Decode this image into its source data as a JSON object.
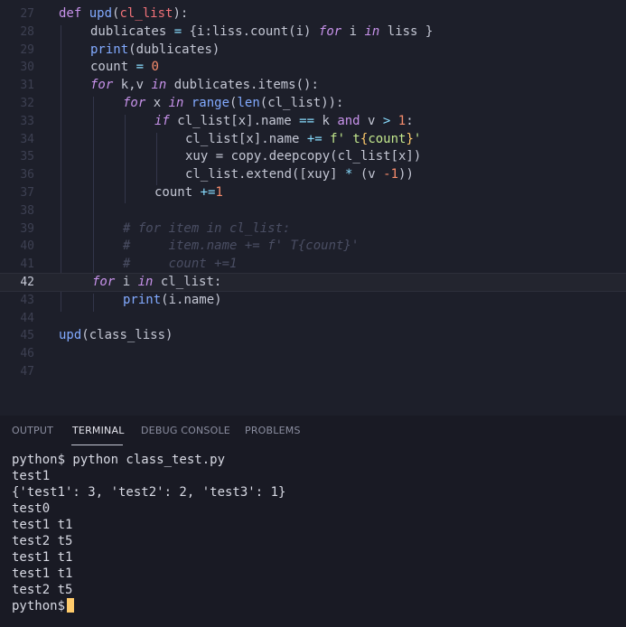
{
  "editor": {
    "lines": [
      {
        "num": "27"
      },
      {
        "num": "28"
      },
      {
        "num": "29"
      },
      {
        "num": "30"
      },
      {
        "num": "31"
      },
      {
        "num": "32"
      },
      {
        "num": "33"
      },
      {
        "num": "34"
      },
      {
        "num": "35"
      },
      {
        "num": "36"
      },
      {
        "num": "37"
      },
      {
        "num": "38"
      },
      {
        "num": "39"
      },
      {
        "num": "40"
      },
      {
        "num": "41"
      },
      {
        "num": "42"
      },
      {
        "num": "43"
      },
      {
        "num": "44"
      },
      {
        "num": "45"
      },
      {
        "num": "46"
      },
      {
        "num": "47"
      }
    ],
    "code": {
      "l27": {
        "def": "def",
        "fn": "upd",
        "p1": "(",
        "arg": "cl_list",
        "p2": "):"
      },
      "l28": {
        "a": "dublicates",
        "eq": " = ",
        "b": "{i:liss.count(i) ",
        "for": "for",
        "c": " i ",
        "in": "in",
        "d": " liss }"
      },
      "l29": {
        "fn": "print",
        "a": "(dublicates)"
      },
      "l30": {
        "a": "count",
        "eq": " = ",
        "n": "0"
      },
      "l31": {
        "for": "for",
        "a": " k,v ",
        "in": "in",
        "b": " dublicates.items():"
      },
      "l32": {
        "for": "for",
        "a": " x ",
        "in": "in",
        "fn1": " range",
        "b": "(",
        "fn2": "len",
        "c": "(cl_list)):"
      },
      "l33": {
        "if": "if",
        "a": " cl_list[x].name ",
        "op": "==",
        "b": " k ",
        "and": "and",
        "c": " v ",
        "gt": ">",
        "n": " 1",
        "d": ":"
      },
      "l34": {
        "a": "cl_list[x].name ",
        "op": "+=",
        "s1": " f' t",
        "b1": "{",
        "v": "count",
        "b2": "}",
        "s2": "'"
      },
      "l35": {
        "a": "xuy = copy.deepcopy(cl_list[x])"
      },
      "l36": {
        "a": "cl_list.extend([xuy] ",
        "op": "*",
        "b": " (v ",
        "n": "-1",
        "c": "))"
      },
      "l37": {
        "a": "count ",
        "op": "+=",
        "n": "1"
      },
      "l39": {
        "c": "# for item in cl_list:"
      },
      "l40": {
        "c": "#     item.name += f' T{count}'"
      },
      "l41": {
        "c": "#     count +=1"
      },
      "l42": {
        "for": "for",
        "a": " i ",
        "in": "in",
        "b": " cl_list:"
      },
      "l43": {
        "fn": "print",
        "a": "(i.name)"
      },
      "l45": {
        "fn": "upd",
        "a": "(class_liss)"
      }
    }
  },
  "panel": {
    "tabs": [
      {
        "label": "OUTPUT"
      },
      {
        "label": "TERMINAL"
      },
      {
        "label": "DEBUG CONSOLE"
      },
      {
        "label": "PROBLEMS"
      }
    ],
    "active_tab": "TERMINAL",
    "terminal_lines": [
      "python$ python class_test.py",
      "test1",
      "{'test1': 3, 'test2': 2, 'test3': 1}",
      "test0",
      "test1 t1",
      "test2 t5",
      "test1 t1",
      "test1 t1",
      "test2 t5"
    ],
    "prompt": "python$"
  },
  "colors": {
    "editor_bg": "#1d1f2a",
    "panel_bg": "#191a24",
    "keyword": "#c792ea",
    "function": "#82aaff",
    "param": "#f07178",
    "number": "#f78c6c",
    "cursor": "#ffcb6b"
  }
}
